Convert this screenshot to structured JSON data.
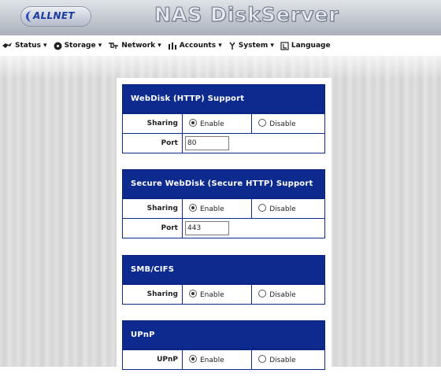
{
  "header": {
    "logo": "ALLNET",
    "title": "NAS DiskServer"
  },
  "nav": {
    "items": [
      {
        "label": "Status ▾",
        "icon": "status-icon"
      },
      {
        "label": "Storage ▾",
        "icon": "storage-icon"
      },
      {
        "label": "Network ▾",
        "icon": "network-icon"
      },
      {
        "label": "Accounts ▾",
        "icon": "accounts-icon"
      },
      {
        "label": "System ▾",
        "icon": "system-icon"
      },
      {
        "label": "Language",
        "icon": "language-icon"
      }
    ]
  },
  "colors": {
    "section_header_bg": "#0d2b8e",
    "label_text": "#0d2b8e"
  },
  "sections": [
    {
      "title": "WebDisk (HTTP) Support",
      "sharing_label": "Sharing",
      "enable_label": "Enable",
      "disable_label": "Disable",
      "selected": "Enable",
      "port_label": "Port",
      "port_value": "80"
    },
    {
      "title": "Secure WebDisk (Secure HTTP) Support",
      "sharing_label": "Sharing",
      "enable_label": "Enable",
      "disable_label": "Disable",
      "selected": "Enable",
      "port_label": "Port",
      "port_value": "443"
    },
    {
      "title": "SMB/CIFS",
      "sharing_label": "Sharing",
      "enable_label": "Enable",
      "disable_label": "Disable",
      "selected": "Enable"
    },
    {
      "title": "UPnP",
      "upnp_label": "UPnP",
      "enable_label": "Enable",
      "disable_label": "Disable",
      "selected": "Enable"
    }
  ]
}
